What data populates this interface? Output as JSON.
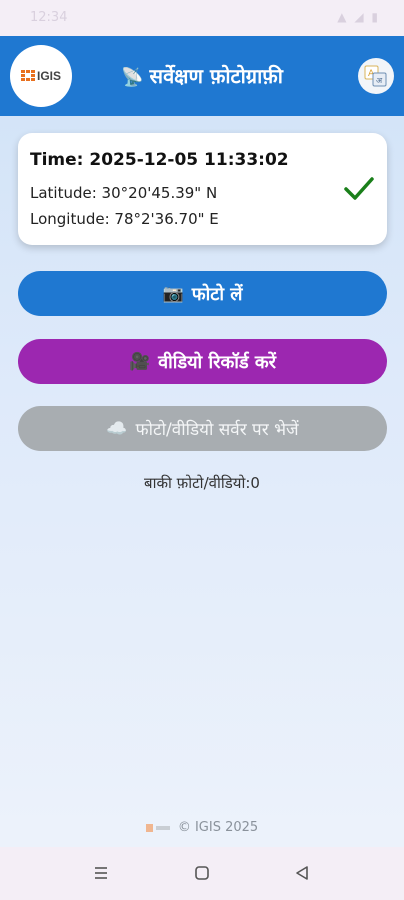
{
  "status_bar": {
    "time": "12:34",
    "icons": "▲ ◢ ▮"
  },
  "header": {
    "logo_text": "IGIS",
    "title_icon": "📡",
    "title": "सर्वेक्षण फ़ोटोग्राफ़ी",
    "lang_icon": "translate-icon"
  },
  "info_card": {
    "time": "Time: 2025-12-05 11:33:02",
    "latitude": "Latitude: 30°20'45.39\" N",
    "longitude": "Longitude: 78°2'36.70\" E",
    "status_icon": "check-icon",
    "status_color": "#1a7f1a"
  },
  "buttons": {
    "photo": {
      "icon": "📷",
      "label": "फोटो लें",
      "color": "#1f78d1"
    },
    "video": {
      "icon": "🎥",
      "label": "वीडियो रिकॉर्ड करें",
      "color": "#9c27b0"
    },
    "upload": {
      "icon": "☁️",
      "label": "फोटो/वीडियो सर्वर पर भेजें",
      "color": "#a8adb1"
    }
  },
  "pending": "बाकी फ़ोटो/वीडियो:0",
  "footer": {
    "text": "© IGIS 2025"
  },
  "nav": {
    "recents_icon": "menu-lines-icon",
    "home_icon": "square-home-icon",
    "back_icon": "triangle-back-icon"
  }
}
